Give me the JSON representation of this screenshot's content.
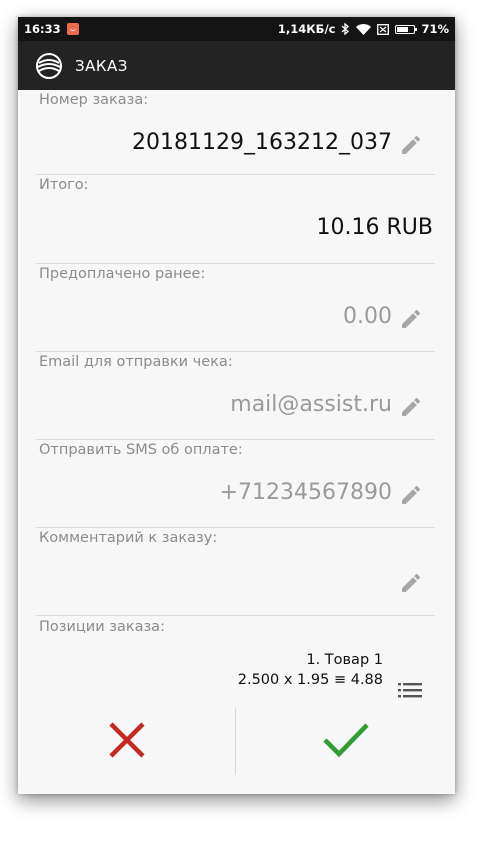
{
  "status_bar": {
    "time": "16:33",
    "network_speed": "1,14КБ/с",
    "battery": "71%",
    "icons": [
      "notification-icon",
      "bluetooth-icon",
      "wifi-icon",
      "sim-icon",
      "battery-icon"
    ]
  },
  "app_bar": {
    "logo_icon": "assist-logo-icon",
    "title": "ЗАКАЗ"
  },
  "fields": {
    "order_number": {
      "label": "Номер заказа:",
      "value": "20181129_163212_037"
    },
    "total": {
      "label": "Итого:",
      "value": "10.16 RUB"
    },
    "prepaid": {
      "label": "Предоплачено ранее:",
      "value": "0.00"
    },
    "email": {
      "label": "Email для отправки чека:",
      "value": "mail@assist.ru"
    },
    "sms": {
      "label": "Отправить SMS об оплате:",
      "value": "+71234567890"
    },
    "comment": {
      "label": "Комментарий к заказу:",
      "value": ""
    }
  },
  "positions": {
    "label": "Позиции заказа:",
    "items": [
      {
        "name": "1. Товар 1",
        "calc": "2.500 x 1.95 ≡ 4.88"
      }
    ]
  },
  "actions": {
    "cancel_icon": "close-icon",
    "confirm_icon": "checkmark-icon"
  },
  "colors": {
    "cancel": "#c62828",
    "confirm": "#2e9d32",
    "app_bar": "#232323",
    "status_bar": "#141414"
  }
}
